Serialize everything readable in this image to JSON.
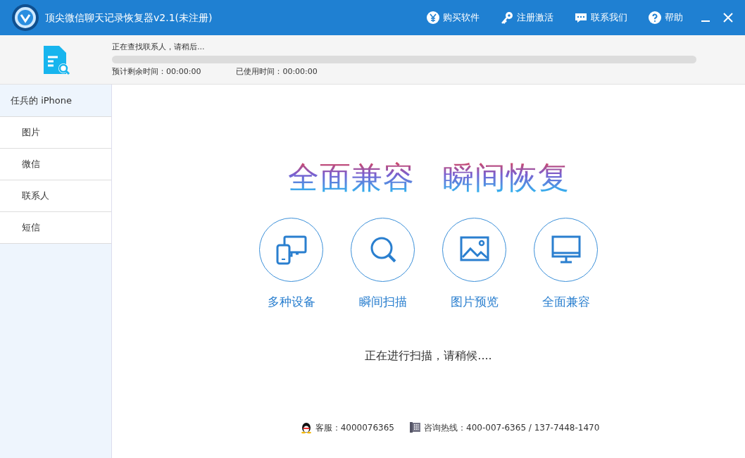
{
  "window": {
    "title": "顶尖微信聊天记录恢复器v2.1(未注册)"
  },
  "title_actions": [
    {
      "kind": "buy",
      "label": "购买软件"
    },
    {
      "kind": "key",
      "label": "注册激活"
    },
    {
      "kind": "chat",
      "label": "联系我们"
    },
    {
      "kind": "help",
      "label": "帮助"
    }
  ],
  "window_controls": [
    {
      "kind": "minimize"
    },
    {
      "kind": "close"
    }
  ],
  "progress": {
    "status": "正在查找联系人，请稍后...",
    "level": 0,
    "remaining": "预计剩余时间：00:00:00",
    "elapsed": "已使用时间：00:00:00"
  },
  "sidebar": {
    "device": "任兵的 iPhone",
    "items": [
      {
        "label": "图片",
        "selected": false
      },
      {
        "label": "微信",
        "selected": false
      },
      {
        "label": "联系人",
        "selected": false
      },
      {
        "label": "短信",
        "selected": false
      }
    ]
  },
  "headline": [
    "全面兼容",
    "瞬间恢复"
  ],
  "features": [
    {
      "kind": "devices",
      "label": "多种设备"
    },
    {
      "kind": "search",
      "label": "瞬间扫描"
    },
    {
      "kind": "image",
      "label": "图片预览"
    },
    {
      "kind": "monitor",
      "label": "全面兼容"
    }
  ],
  "scan_status": "正在进行扫描，请稍候....",
  "footer": [
    {
      "kind": "qq",
      "text": "客服：4000076365"
    },
    {
      "kind": "phone",
      "text": "咨询热线：400-007-6365 / 137-7448-1470"
    }
  ]
}
